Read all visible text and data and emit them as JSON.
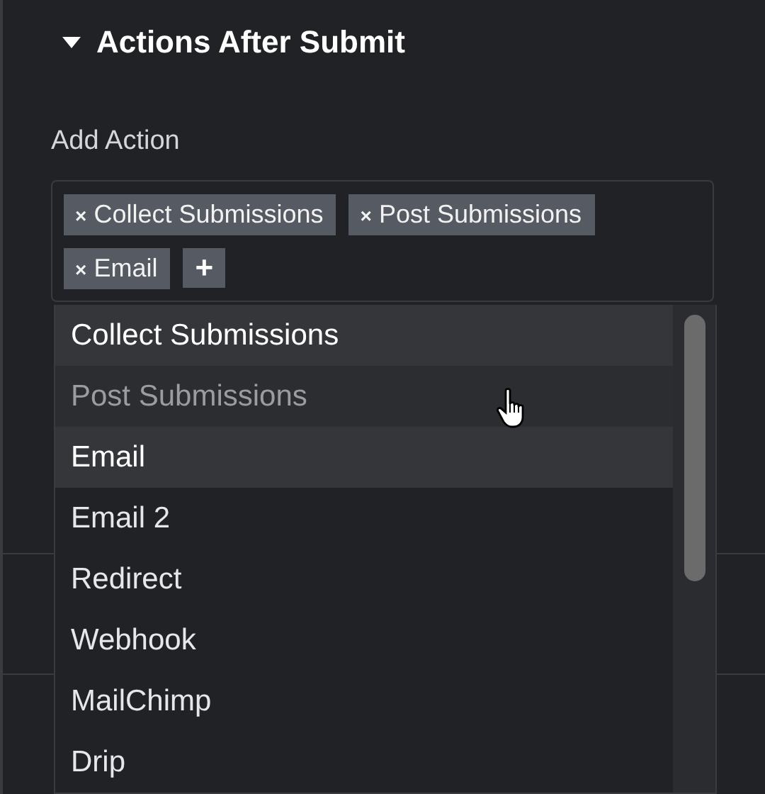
{
  "section": {
    "title": "Actions After Submit",
    "expanded": true
  },
  "field": {
    "label": "Add Action",
    "tags": [
      {
        "label": "Collect Submissions"
      },
      {
        "label": "Post Submissions"
      },
      {
        "label": "Email"
      }
    ],
    "add_symbol": "+",
    "remove_symbol": "×"
  },
  "dropdown": {
    "options": [
      {
        "label": "Collect Submissions",
        "selected": true,
        "hovered": false
      },
      {
        "label": "Post Submissions",
        "selected": true,
        "hovered": true
      },
      {
        "label": "Email",
        "selected": true,
        "hovered": false
      },
      {
        "label": "Email 2",
        "selected": false,
        "hovered": false
      },
      {
        "label": "Redirect",
        "selected": false,
        "hovered": false
      },
      {
        "label": "Webhook",
        "selected": false,
        "hovered": false
      },
      {
        "label": "MailChimp",
        "selected": false,
        "hovered": false
      },
      {
        "label": "Drip",
        "selected": false,
        "hovered": false
      }
    ]
  }
}
